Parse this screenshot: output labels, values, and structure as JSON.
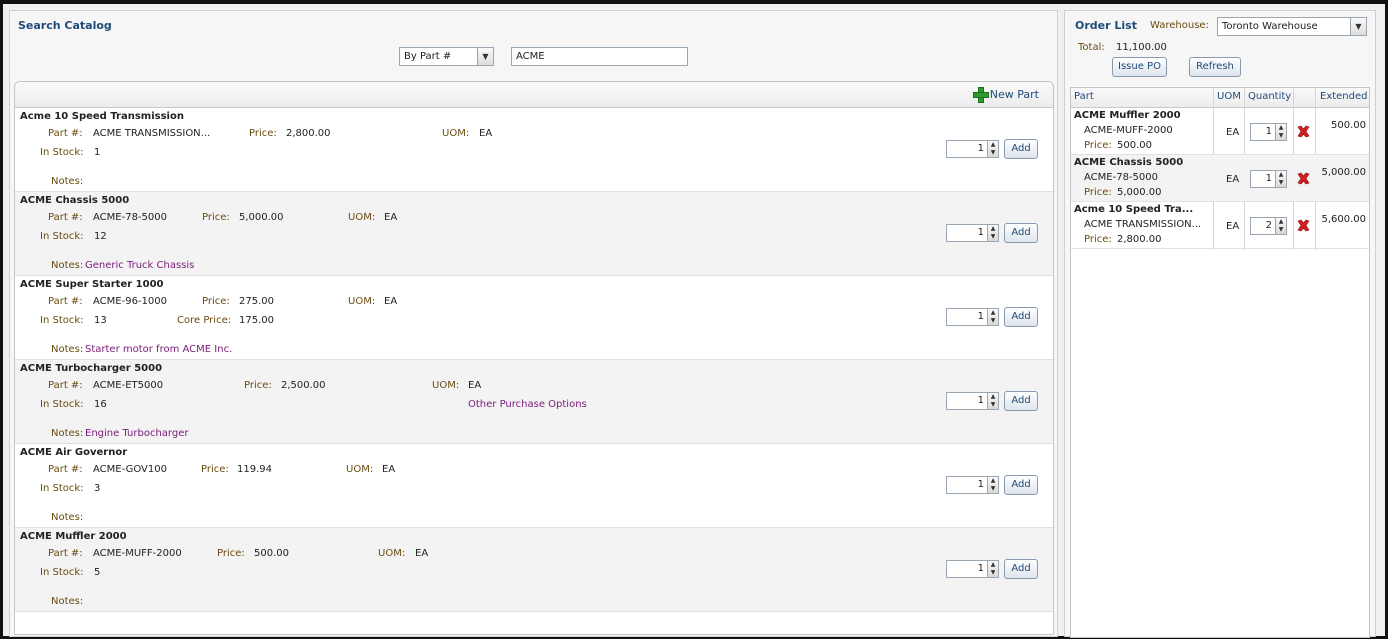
{
  "search": {
    "title": "Search Catalog",
    "mode": "By Part #",
    "query": "ACME",
    "new_part": "New Part"
  },
  "labels": {
    "part": "Part #:",
    "price": "Price:",
    "uom": "UOM:",
    "in_stock": "In Stock:",
    "core_price": "Core Price:",
    "notes": "Notes:",
    "add": "Add"
  },
  "parts": [
    {
      "name": "Acme 10 Speed Transmission",
      "part": "ACME TRANSMISSION...",
      "price": "2,800.00",
      "uom": "EA",
      "stock": "1",
      "notes": "",
      "qty": "1"
    },
    {
      "name": "ACME Chassis 5000",
      "part": "ACME-78-5000",
      "price": "5,000.00",
      "uom": "EA",
      "stock": "12",
      "notes": "Generic Truck Chassis",
      "qty": "1"
    },
    {
      "name": "ACME Super Starter 1000",
      "part": "ACME-96-1000",
      "price": "275.00",
      "uom": "EA",
      "stock": "13",
      "core_price": "175.00",
      "notes": "Starter motor from ACME Inc.",
      "qty": "1"
    },
    {
      "name": "ACME Turbocharger 5000",
      "part": "ACME-ET5000",
      "price": "2,500.00",
      "uom": "EA",
      "stock": "16",
      "link": "Other Purchase Options",
      "notes": "Engine Turbocharger",
      "qty": "1"
    },
    {
      "name": "ACME Air Governor",
      "part": "ACME-GOV100",
      "price": "119.94",
      "uom": "EA",
      "stock": "3",
      "notes": "",
      "qty": "1"
    },
    {
      "name": "ACME Muffler 2000",
      "part": "ACME-MUFF-2000",
      "price": "500.00",
      "uom": "EA",
      "stock": "5",
      "notes": "",
      "qty": "1"
    }
  ],
  "order": {
    "title": "Order List",
    "warehouse_label": "Warehouse:",
    "warehouse": "Toronto Warehouse",
    "total_label": "Total:",
    "total": "11,100.00",
    "issue_po": "Issue PO",
    "refresh": "Refresh",
    "columns": {
      "part": "Part",
      "uom": "UOM",
      "quantity": "Quantity",
      "extended": "Extended"
    },
    "price_label": "Price:",
    "items": [
      {
        "name": "ACME Muffler 2000",
        "part": "ACME-MUFF-2000",
        "price": "500.00",
        "uom": "EA",
        "qty": "1",
        "extended": "500.00"
      },
      {
        "name": "ACME Chassis 5000",
        "part": "ACME-78-5000",
        "price": "5,000.00",
        "uom": "EA",
        "qty": "1",
        "extended": "5,000.00"
      },
      {
        "name": "Acme 10 Speed Tra...",
        "part": "ACME TRANSMISSION...",
        "price": "2,800.00",
        "uom": "EA",
        "qty": "2",
        "extended": "5,600.00"
      }
    ]
  },
  "colors": {
    "title": "#1f4b79",
    "label": "#6b4b0f",
    "note": "#7a1a7a",
    "delete": "#d42020"
  }
}
